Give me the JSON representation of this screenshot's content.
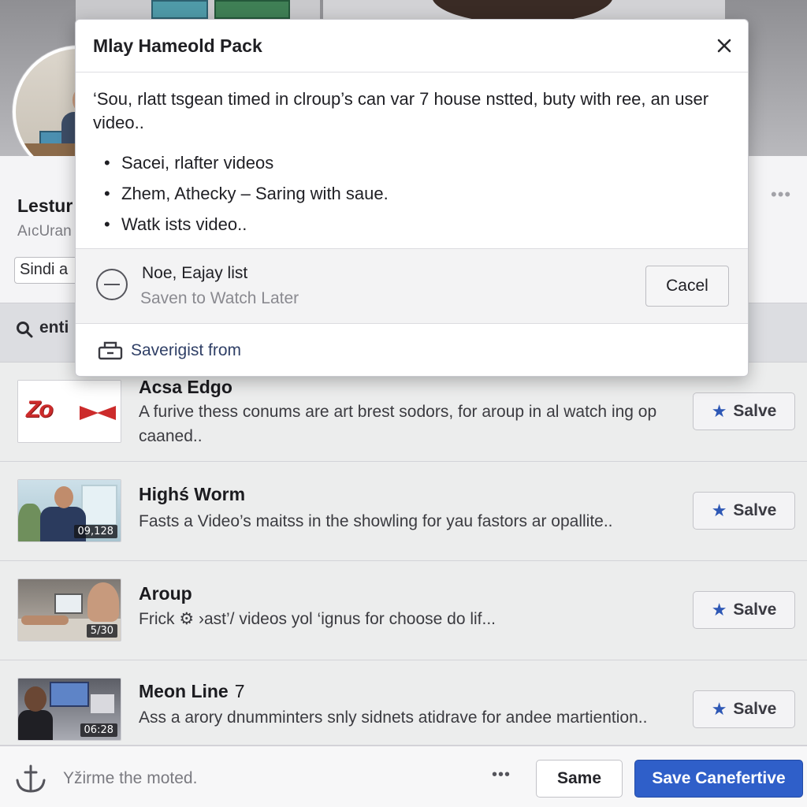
{
  "background": {
    "channel_title": "Lestur",
    "channel_subtitle": "AıcUran",
    "sort_label": "Sindi a",
    "more_glyph": "•••",
    "search_text": "enti"
  },
  "modal": {
    "title": "Mlay Hameold Pack",
    "close_glyph": "✕",
    "description": "‘Sou, rlatt tsgean timed in clroup’s can var 7 house nstted, buty with ree, an user video..",
    "bullets": [
      "Sacei, rlafter videos",
      "Zhem, Athecky – Saring with saue.",
      "Watk ists video.."
    ],
    "playlist": {
      "name": "Noe, Eajay list",
      "status": "Saven to Watch Later",
      "cancel_label": "Cacel"
    },
    "save_from_label": "Saverigist from"
  },
  "videos": [
    {
      "title": "Acsa Edgo",
      "suffix": "",
      "description": "A furive thess conums are art brest sodors, for aroup in al watch ing op caaned..",
      "thumbnail": "zoom-logo",
      "logo_text": "Zo",
      "duration": "",
      "save_label": "Salve"
    },
    {
      "title": "Highś Worm",
      "suffix": "",
      "description": "Fasts a Video’s maitss in the showling for yau fastors ar opallite..",
      "thumbnail": "office-man",
      "duration": "09,128",
      "save_label": "Salve"
    },
    {
      "title": "Aroup",
      "suffix": "",
      "description": "Frick ⚙ ›ast’/ videos yol ‘ignus for choose do lif...",
      "thumbnail": "desk-laptop",
      "duration": "5/30",
      "save_label": "Salve"
    },
    {
      "title": "Meon Line",
      "suffix": "7",
      "description": "Ass a arory dnumminters snly sidnets atidrave for andee martiention..",
      "thumbnail": "studio-person",
      "duration": "06:28",
      "save_label": "Salve"
    }
  ],
  "footer": {
    "hint_text": "Yžirme the moted.",
    "more_glyph": "•••",
    "secondary_label": "Same",
    "primary_label": "Save Canefertive"
  },
  "colors": {
    "accent": "#2f5fc9",
    "star": "#2d57b5",
    "logo_red": "#cc2b2b"
  },
  "icons": {
    "close": "close-icon",
    "search": "search-icon",
    "playlist": "playlist-icon",
    "save_from": "save-tray-icon",
    "star": "star-icon",
    "anchor": "anchor-icon"
  }
}
